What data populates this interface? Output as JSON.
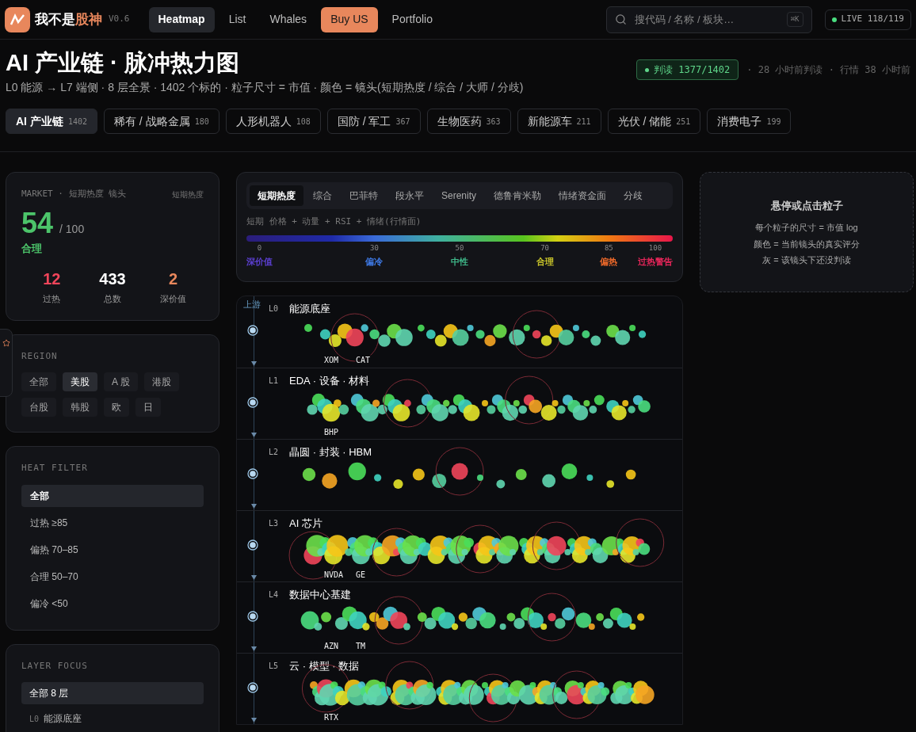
{
  "app": {
    "name_prefix": "我不是",
    "name_accent": "股神",
    "version": "V0.6"
  },
  "nav": [
    {
      "label": "Heatmap",
      "selected": true,
      "kind": "tab"
    },
    {
      "label": "List",
      "selected": false,
      "kind": "tab"
    },
    {
      "label": "Whales",
      "selected": false,
      "kind": "tab"
    },
    {
      "label": "Buy US",
      "selected": false,
      "kind": "promo"
    },
    {
      "label": "Portfolio",
      "selected": false,
      "kind": "tab"
    }
  ],
  "search": {
    "placeholder": "搜代码 / 名称 / 板块…",
    "shortcut": "⌘K"
  },
  "live": {
    "label": "LIVE 118/119"
  },
  "page": {
    "title": "AI 产业链 · 脉冲热力图",
    "subtitle": "L0 能源 → L7 端侧 · 8 层全景 · 1402 个标的 · 粒子尺寸 = 市值 · 颜色 = 镜头(短期热度 / 综合 / 大师 / 分歧)",
    "judged": "判读 1377/1402",
    "meta": "· 28 小时前判读 · 行情 38 小时前"
  },
  "sectors": [
    {
      "name": "AI 产业链",
      "count": "1402",
      "selected": true
    },
    {
      "name": "稀有 / 战略金属",
      "count": "180",
      "selected": false
    },
    {
      "name": "人形机器人",
      "count": "108",
      "selected": false
    },
    {
      "name": "国防 / 军工",
      "count": "367",
      "selected": false
    },
    {
      "name": "生物医药",
      "count": "363",
      "selected": false
    },
    {
      "name": "新能源车",
      "count": "211",
      "selected": false
    },
    {
      "name": "光伏 / 储能",
      "count": "251",
      "selected": false
    },
    {
      "name": "消费电子",
      "count": "199",
      "selected": false
    }
  ],
  "market": {
    "label": "MARKET · 短期热度 镜头",
    "lens": "短期热度",
    "score": "54",
    "max": "/ 100",
    "verdict": "合理",
    "stats": [
      {
        "value": "12",
        "label": "过热",
        "color": "#f0455a"
      },
      {
        "value": "433",
        "label": "总数",
        "color": "#ffffff"
      },
      {
        "value": "2",
        "label": "深价值",
        "color": "#e8875c"
      }
    ]
  },
  "region": {
    "title": "REGION",
    "options": [
      {
        "label": "全部",
        "selected": false
      },
      {
        "label": "美股",
        "selected": true
      },
      {
        "label": "A 股",
        "selected": false
      },
      {
        "label": "港股",
        "selected": false
      },
      {
        "label": "台股",
        "selected": false
      },
      {
        "label": "韩股",
        "selected": false
      },
      {
        "label": "欧",
        "selected": false
      },
      {
        "label": "日",
        "selected": false
      }
    ]
  },
  "heat_filter": {
    "title": "HEAT FILTER",
    "options": [
      {
        "label": "全部",
        "selected": true
      },
      {
        "label": "过热 ≥85",
        "selected": false
      },
      {
        "label": "偏热 70–85",
        "selected": false
      },
      {
        "label": "合理 50–70",
        "selected": false
      },
      {
        "label": "偏冷 <50",
        "selected": false
      }
    ]
  },
  "layer_focus": {
    "title": "LAYER FOCUS",
    "options": [
      {
        "label": "全部 8 层",
        "selected": true
      },
      {
        "code": "L0",
        "label": "能源底座",
        "selected": false
      }
    ]
  },
  "lenses": {
    "tabs": [
      {
        "label": "短期热度",
        "selected": true
      },
      {
        "label": "综合",
        "selected": false
      },
      {
        "label": "巴菲特",
        "selected": false
      },
      {
        "label": "段永平",
        "selected": false
      },
      {
        "label": "Serenity",
        "selected": false
      },
      {
        "label": "德鲁肯米勒",
        "selected": false
      },
      {
        "label": "情绪资金面",
        "selected": false
      },
      {
        "label": "分歧",
        "selected": false
      }
    ],
    "formula": "短期 价格 + 动量 + RSI + 情绪(行情面)",
    "scale": [
      {
        "value": "0",
        "label": "深价值",
        "color": "#5b3fd0"
      },
      {
        "value": "30",
        "label": "偏冷",
        "color": "#3f7be8"
      },
      {
        "value": "50",
        "label": "中性",
        "color": "#3fb98a"
      },
      {
        "value": "70",
        "label": "合理",
        "color": "#c9c52a"
      },
      {
        "value": "85",
        "label": "偏热",
        "color": "#f06a2a"
      },
      {
        "value": "100",
        "label": "过热警告",
        "color": "#e8265a"
      }
    ]
  },
  "heatmap": {
    "upstream": "上游",
    "layers": [
      {
        "code": "L0",
        "name": "能源底座",
        "tickers": [
          "XOM",
          "CAT"
        ]
      },
      {
        "code": "L1",
        "name": "EDA · 设备 · 材料",
        "tickers": [
          "BHP"
        ]
      },
      {
        "code": "L2",
        "name": "晶圆 · 封装 · HBM"
      },
      {
        "code": "L3",
        "name": "AI 芯片",
        "tickers": [
          "NVDA",
          "GE"
        ]
      },
      {
        "code": "L4",
        "name": "数据中心基建",
        "tickers": [
          "AZN",
          "TM"
        ]
      },
      {
        "code": "L5",
        "name": "云 · 模型 · 数据",
        "tickers": [
          "RTX"
        ]
      }
    ]
  },
  "hint": {
    "title": "悬停或点击粒子",
    "lines": [
      "每个粒子的尺寸 = 市值 log",
      "颜色 = 当前镜头的真实评分",
      "灰 = 该镜头下还没判读"
    ]
  }
}
